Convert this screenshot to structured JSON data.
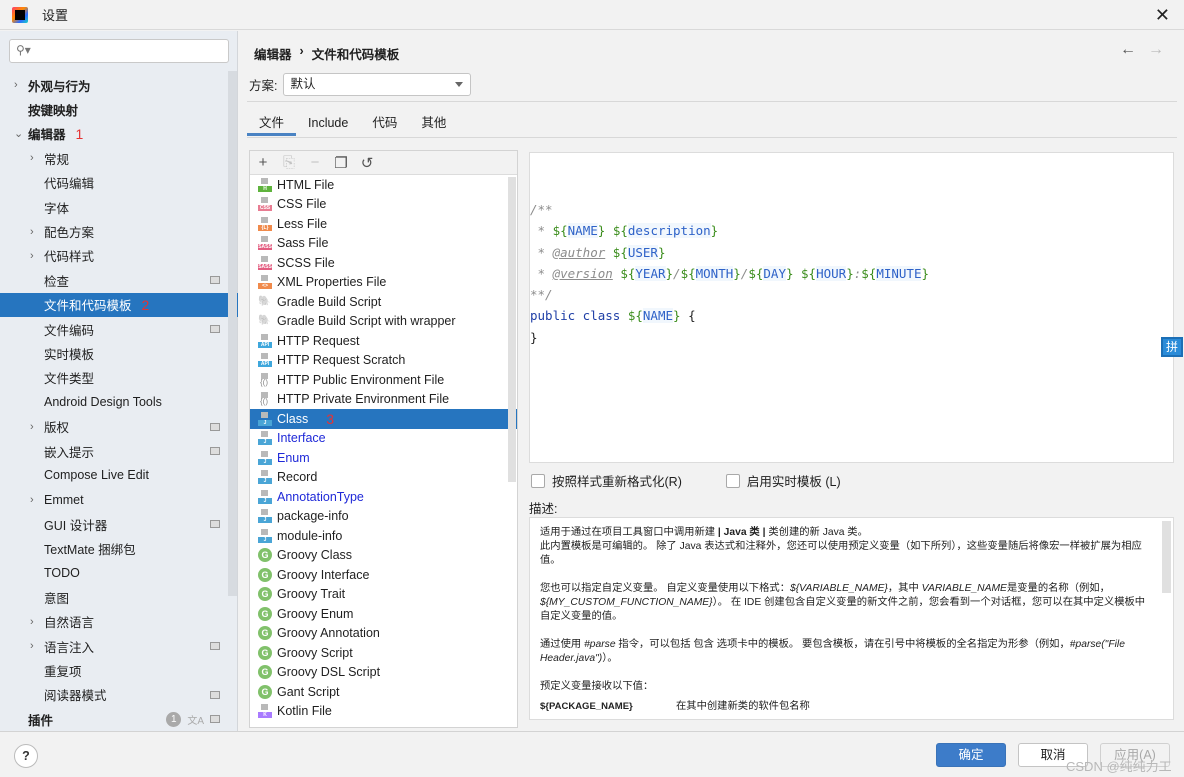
{
  "window": {
    "title": "设置",
    "close_icon": "close-icon"
  },
  "search": {
    "placeholder": "",
    "value": ""
  },
  "sidebar": {
    "items": [
      {
        "label": "外观与行为",
        "level": 0,
        "expandable": true,
        "expanded": false,
        "bold": true
      },
      {
        "label": "按键映射",
        "level": 0,
        "expandable": false,
        "bold": true
      },
      {
        "label": "编辑器",
        "level": 0,
        "expandable": true,
        "expanded": true,
        "bold": true,
        "annotation": "1"
      },
      {
        "label": "常规",
        "level": 1,
        "expandable": true
      },
      {
        "label": "代码编辑",
        "level": 1
      },
      {
        "label": "字体",
        "level": 1
      },
      {
        "label": "配色方案",
        "level": 1,
        "expandable": true
      },
      {
        "label": "代码样式",
        "level": 1,
        "expandable": true
      },
      {
        "label": "检查",
        "level": 1,
        "project_icon": true
      },
      {
        "label": "文件和代码模板",
        "level": 1,
        "selected": true,
        "annotation": "2"
      },
      {
        "label": "文件编码",
        "level": 1,
        "project_icon": true
      },
      {
        "label": "实时模板",
        "level": 1
      },
      {
        "label": "文件类型",
        "level": 1
      },
      {
        "label": "Android Design Tools",
        "level": 1
      },
      {
        "label": "版权",
        "level": 1,
        "expandable": true,
        "project_icon": true
      },
      {
        "label": "嵌入提示",
        "level": 1,
        "project_icon": true
      },
      {
        "label": "Compose Live Edit",
        "level": 1
      },
      {
        "label": "Emmet",
        "level": 1,
        "expandable": true
      },
      {
        "label": "GUI 设计器",
        "level": 1,
        "project_icon": true
      },
      {
        "label": "TextMate 捆绑包",
        "level": 1
      },
      {
        "label": "TODO",
        "level": 1
      },
      {
        "label": "意图",
        "level": 1
      },
      {
        "label": "自然语言",
        "level": 1,
        "expandable": true
      },
      {
        "label": "语言注入",
        "level": 1,
        "expandable": true,
        "project_icon": true
      },
      {
        "label": "重复项",
        "level": 1
      },
      {
        "label": "阅读器模式",
        "level": 1,
        "project_icon": true
      },
      {
        "label": "插件",
        "level": 0,
        "bold": true,
        "badge": "1",
        "translate_icon": true,
        "project_icon": true
      }
    ]
  },
  "header": {
    "breadcrumb": [
      "编辑器",
      "文件和代码模板"
    ],
    "breadcrumb_sep": "›",
    "back_icon": "←",
    "forward_icon": "→"
  },
  "scheme": {
    "label": "方案:",
    "value": "默认"
  },
  "tabs": [
    {
      "label": "文件",
      "active": true
    },
    {
      "label": "Include"
    },
    {
      "label": "代码"
    },
    {
      "label": "其他"
    }
  ],
  "toolbar": {
    "add": "+",
    "copy_file": "⎘",
    "remove": "−",
    "duplicate": "❐",
    "reset": "↺"
  },
  "templates": [
    {
      "name": "HTML File",
      "icon": "html",
      "color": "#5fb33d",
      "tag": "H"
    },
    {
      "name": "CSS File",
      "icon": "css",
      "color": "#e87c92",
      "tag": "CSS"
    },
    {
      "name": "Less File",
      "icon": "less",
      "color": "#f08a4b",
      "tag": "{L}"
    },
    {
      "name": "Sass File",
      "icon": "sass",
      "color": "#e35d80",
      "tag": "SASS"
    },
    {
      "name": "SCSS File",
      "icon": "scss",
      "color": "#e35d80",
      "tag": "SASS"
    },
    {
      "name": "XML Properties File",
      "icon": "xml",
      "color": "#f08a4b",
      "tag": "<>"
    },
    {
      "name": "Gradle Build Script",
      "icon": "gradle"
    },
    {
      "name": "Gradle Build Script with wrapper",
      "icon": "gradle"
    },
    {
      "name": "HTTP Request",
      "icon": "api",
      "color": "#3ea7dc",
      "tag": "API"
    },
    {
      "name": "HTTP Request Scratch",
      "icon": "api",
      "color": "#3ea7dc",
      "tag": "API"
    },
    {
      "name": "HTTP Public Environment File",
      "icon": "env"
    },
    {
      "name": "HTTP Private Environment File",
      "icon": "env"
    },
    {
      "name": "Class",
      "icon": "java",
      "color": "#4aa5d6",
      "tag": "J",
      "selected": true,
      "annotation": "3"
    },
    {
      "name": "Interface",
      "icon": "java",
      "color": "#4aa5d6",
      "tag": "J",
      "modified": true
    },
    {
      "name": "Enum",
      "icon": "java",
      "color": "#4aa5d6",
      "tag": "J",
      "modified": true
    },
    {
      "name": "Record",
      "icon": "java",
      "color": "#4aa5d6",
      "tag": "J"
    },
    {
      "name": "AnnotationType",
      "icon": "java",
      "color": "#4aa5d6",
      "tag": "J",
      "modified": true
    },
    {
      "name": "package-info",
      "icon": "java",
      "color": "#4aa5d6",
      "tag": "J"
    },
    {
      "name": "module-info",
      "icon": "java",
      "color": "#4aa5d6",
      "tag": "J"
    },
    {
      "name": "Groovy Class",
      "icon": "groovy",
      "tag": "G"
    },
    {
      "name": "Groovy Interface",
      "icon": "groovy",
      "tag": "G"
    },
    {
      "name": "Groovy Trait",
      "icon": "groovy",
      "tag": "G"
    },
    {
      "name": "Groovy Enum",
      "icon": "groovy",
      "tag": "G"
    },
    {
      "name": "Groovy Annotation",
      "icon": "groovy",
      "tag": "G"
    },
    {
      "name": "Groovy Script",
      "icon": "groovy",
      "tag": "G"
    },
    {
      "name": "Groovy DSL Script",
      "icon": "groovy",
      "tag": "G"
    },
    {
      "name": "Gant Script",
      "icon": "groovy",
      "tag": "G"
    },
    {
      "name": "Kotlin File",
      "icon": "kotlin",
      "color": "#a97bff",
      "tag": "K"
    }
  ],
  "editor": {
    "lines": [
      [],
      [],
      [
        {
          "t": "/**",
          "c": "cmt"
        }
      ],
      [
        {
          "t": " * ",
          "c": "cmt"
        },
        {
          "t": "${",
          "c": "dol"
        },
        {
          "t": "NAME",
          "c": "var"
        },
        {
          "t": "}",
          "c": "dol"
        },
        {
          "t": " ",
          "c": "pl"
        },
        {
          "t": "${",
          "c": "dol"
        },
        {
          "t": "description",
          "c": "var"
        },
        {
          "t": "}",
          "c": "dol"
        }
      ],
      [
        {
          "t": " * ",
          "c": "cmt"
        },
        {
          "t": "@author",
          "c": "tag"
        },
        {
          "t": " ",
          "c": "pl"
        },
        {
          "t": "${",
          "c": "dol"
        },
        {
          "t": "USER",
          "c": "var"
        },
        {
          "t": "}",
          "c": "dol"
        }
      ],
      [
        {
          "t": " * ",
          "c": "cmt"
        },
        {
          "t": "@version",
          "c": "tag"
        },
        {
          "t": " ",
          "c": "pl"
        },
        {
          "t": "${",
          "c": "dol"
        },
        {
          "t": "YEAR",
          "c": "var"
        },
        {
          "t": "}",
          "c": "dol"
        },
        {
          "t": "/",
          "c": "cmt"
        },
        {
          "t": "${",
          "c": "dol"
        },
        {
          "t": "MONTH",
          "c": "var"
        },
        {
          "t": "}",
          "c": "dol"
        },
        {
          "t": "/",
          "c": "cmt"
        },
        {
          "t": "${",
          "c": "dol"
        },
        {
          "t": "DAY",
          "c": "var"
        },
        {
          "t": "}",
          "c": "dol"
        },
        {
          "t": " ",
          "c": "pl"
        },
        {
          "t": "${",
          "c": "dol"
        },
        {
          "t": "HOUR",
          "c": "var"
        },
        {
          "t": "}",
          "c": "dol"
        },
        {
          "t": ":",
          "c": "cmt"
        },
        {
          "t": "${",
          "c": "dol"
        },
        {
          "t": "MINUTE",
          "c": "var"
        },
        {
          "t": "}",
          "c": "dol"
        }
      ],
      [
        {
          "t": "**/",
          "c": "cmt"
        }
      ],
      [
        {
          "t": "public class ",
          "c": "kw"
        },
        {
          "t": "${",
          "c": "dol"
        },
        {
          "t": "NAME",
          "c": "var"
        },
        {
          "t": "}",
          "c": "dol"
        },
        {
          "t": " {",
          "c": "pl"
        }
      ],
      [
        {
          "t": "}",
          "c": "pl"
        }
      ]
    ]
  },
  "options": {
    "reformat": {
      "label": "按照样式重新格式化(R)",
      "checked": false
    },
    "live_templates": {
      "label": "启用实时模板 (L)",
      "checked": false
    }
  },
  "description": {
    "label": "描述:",
    "p1_a": "适用于通过在项目工具窗口中调用新建 ",
    "p1_b": "| Java 类 |",
    "p1_c": " 类创建的新 Java 类。",
    "p1_d": "此内置模板是可编辑的。 除了 Java 表达式和注释外，您还可以使用预定义变量（如下所列），这些变量随后将像宏一样被扩展为相应值。",
    "p2_a": "您也可以指定自定义变量。 自定义变量使用以下格式：",
    "p2_b": "${VARIABLE_NAME}",
    "p2_c": "，其中 ",
    "p2_d": "VARIABLE_NAME",
    "p2_e": "是变量的名称（例如，",
    "p2_f": "${MY_CUSTOM_FUNCTION_NAME}",
    "p2_g": "）。 在 IDE 创建包含自定义变量的新文件之前，您会看到一个对话框，您可以在其中定义模板中自定义变量的值。",
    "p3_a": "通过使用 ",
    "p3_b": "#parse",
    "p3_c": " 指令，可以包括 包含 选项卡中的模板。 要包含模板，请在引号中将模板的全名指定为形参（例如，",
    "p3_d": "#parse(\"File Header.java\")",
    "p3_e": "）。",
    "p4": "预定义变量接收以下值：",
    "vars": [
      {
        "name": "${PACKAGE_NAME}",
        "desc": "在其中创建新类的软件包名称"
      }
    ]
  },
  "ime_indicator": "拼",
  "footer": {
    "help": "?",
    "ok": "确定",
    "cancel": "取消",
    "apply": "应用(A)",
    "watermark": "CSDN @纯纯力工"
  }
}
